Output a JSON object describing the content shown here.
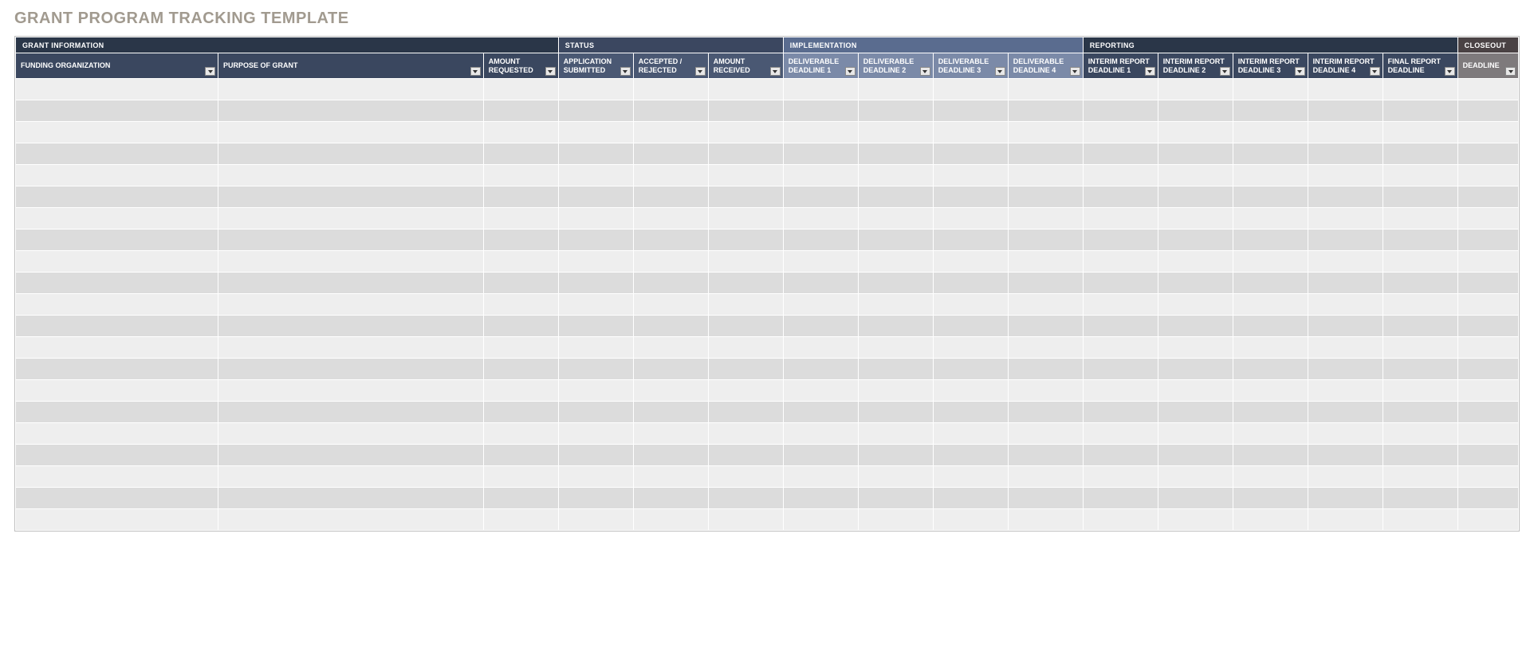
{
  "title": "GRANT PROGRAM TRACKING TEMPLATE",
  "groups": {
    "info": "GRANT INFORMATION",
    "status": "STATUS",
    "impl": "IMPLEMENTATION",
    "report": "REPORTING",
    "close": "CLOSEOUT"
  },
  "columns": {
    "funding_org": "FUNDING ORGANIZATION",
    "purpose": "PURPOSE OF GRANT",
    "amount_requested": "AMOUNT REQUESTED",
    "app_submitted": "APPLICATION SUBMITTED",
    "accepted_rejected": "ACCEPTED / REJECTED",
    "amount_received": "AMOUNT RECEIVED",
    "deliverable1": "DELIVERABLE DEADLINE 1",
    "deliverable2": "DELIVERABLE DEADLINE 2",
    "deliverable3": "DELIVERABLE DEADLINE 3",
    "deliverable4": "DELIVERABLE DEADLINE 4",
    "interim1": "INTERIM REPORT DEADLINE 1",
    "interim2": "INTERIM REPORT DEADLINE 2",
    "interim3": "INTERIM REPORT DEADLINE 3",
    "interim4": "INTERIM REPORT DEADLINE 4",
    "final_report": "FINAL REPORT DEADLINE",
    "deadline": "DEADLINE"
  },
  "row_count": 21
}
